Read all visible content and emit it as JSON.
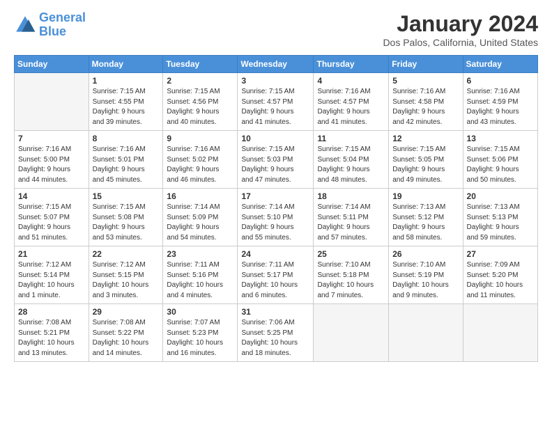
{
  "logo": {
    "line1": "General",
    "line2": "Blue"
  },
  "title": "January 2024",
  "location": "Dos Palos, California, United States",
  "days_of_week": [
    "Sunday",
    "Monday",
    "Tuesday",
    "Wednesday",
    "Thursday",
    "Friday",
    "Saturday"
  ],
  "weeks": [
    [
      {
        "day": "",
        "info": ""
      },
      {
        "day": "1",
        "info": "Sunrise: 7:15 AM\nSunset: 4:55 PM\nDaylight: 9 hours\nand 39 minutes."
      },
      {
        "day": "2",
        "info": "Sunrise: 7:15 AM\nSunset: 4:56 PM\nDaylight: 9 hours\nand 40 minutes."
      },
      {
        "day": "3",
        "info": "Sunrise: 7:15 AM\nSunset: 4:57 PM\nDaylight: 9 hours\nand 41 minutes."
      },
      {
        "day": "4",
        "info": "Sunrise: 7:16 AM\nSunset: 4:57 PM\nDaylight: 9 hours\nand 41 minutes."
      },
      {
        "day": "5",
        "info": "Sunrise: 7:16 AM\nSunset: 4:58 PM\nDaylight: 9 hours\nand 42 minutes."
      },
      {
        "day": "6",
        "info": "Sunrise: 7:16 AM\nSunset: 4:59 PM\nDaylight: 9 hours\nand 43 minutes."
      }
    ],
    [
      {
        "day": "7",
        "info": "Sunrise: 7:16 AM\nSunset: 5:00 PM\nDaylight: 9 hours\nand 44 minutes."
      },
      {
        "day": "8",
        "info": "Sunrise: 7:16 AM\nSunset: 5:01 PM\nDaylight: 9 hours\nand 45 minutes."
      },
      {
        "day": "9",
        "info": "Sunrise: 7:16 AM\nSunset: 5:02 PM\nDaylight: 9 hours\nand 46 minutes."
      },
      {
        "day": "10",
        "info": "Sunrise: 7:15 AM\nSunset: 5:03 PM\nDaylight: 9 hours\nand 47 minutes."
      },
      {
        "day": "11",
        "info": "Sunrise: 7:15 AM\nSunset: 5:04 PM\nDaylight: 9 hours\nand 48 minutes."
      },
      {
        "day": "12",
        "info": "Sunrise: 7:15 AM\nSunset: 5:05 PM\nDaylight: 9 hours\nand 49 minutes."
      },
      {
        "day": "13",
        "info": "Sunrise: 7:15 AM\nSunset: 5:06 PM\nDaylight: 9 hours\nand 50 minutes."
      }
    ],
    [
      {
        "day": "14",
        "info": "Sunrise: 7:15 AM\nSunset: 5:07 PM\nDaylight: 9 hours\nand 51 minutes."
      },
      {
        "day": "15",
        "info": "Sunrise: 7:15 AM\nSunset: 5:08 PM\nDaylight: 9 hours\nand 53 minutes."
      },
      {
        "day": "16",
        "info": "Sunrise: 7:14 AM\nSunset: 5:09 PM\nDaylight: 9 hours\nand 54 minutes."
      },
      {
        "day": "17",
        "info": "Sunrise: 7:14 AM\nSunset: 5:10 PM\nDaylight: 9 hours\nand 55 minutes."
      },
      {
        "day": "18",
        "info": "Sunrise: 7:14 AM\nSunset: 5:11 PM\nDaylight: 9 hours\nand 57 minutes."
      },
      {
        "day": "19",
        "info": "Sunrise: 7:13 AM\nSunset: 5:12 PM\nDaylight: 9 hours\nand 58 minutes."
      },
      {
        "day": "20",
        "info": "Sunrise: 7:13 AM\nSunset: 5:13 PM\nDaylight: 9 hours\nand 59 minutes."
      }
    ],
    [
      {
        "day": "21",
        "info": "Sunrise: 7:12 AM\nSunset: 5:14 PM\nDaylight: 10 hours\nand 1 minute."
      },
      {
        "day": "22",
        "info": "Sunrise: 7:12 AM\nSunset: 5:15 PM\nDaylight: 10 hours\nand 3 minutes."
      },
      {
        "day": "23",
        "info": "Sunrise: 7:11 AM\nSunset: 5:16 PM\nDaylight: 10 hours\nand 4 minutes."
      },
      {
        "day": "24",
        "info": "Sunrise: 7:11 AM\nSunset: 5:17 PM\nDaylight: 10 hours\nand 6 minutes."
      },
      {
        "day": "25",
        "info": "Sunrise: 7:10 AM\nSunset: 5:18 PM\nDaylight: 10 hours\nand 7 minutes."
      },
      {
        "day": "26",
        "info": "Sunrise: 7:10 AM\nSunset: 5:19 PM\nDaylight: 10 hours\nand 9 minutes."
      },
      {
        "day": "27",
        "info": "Sunrise: 7:09 AM\nSunset: 5:20 PM\nDaylight: 10 hours\nand 11 minutes."
      }
    ],
    [
      {
        "day": "28",
        "info": "Sunrise: 7:08 AM\nSunset: 5:21 PM\nDaylight: 10 hours\nand 13 minutes."
      },
      {
        "day": "29",
        "info": "Sunrise: 7:08 AM\nSunset: 5:22 PM\nDaylight: 10 hours\nand 14 minutes."
      },
      {
        "day": "30",
        "info": "Sunrise: 7:07 AM\nSunset: 5:23 PM\nDaylight: 10 hours\nand 16 minutes."
      },
      {
        "day": "31",
        "info": "Sunrise: 7:06 AM\nSunset: 5:25 PM\nDaylight: 10 hours\nand 18 minutes."
      },
      {
        "day": "",
        "info": ""
      },
      {
        "day": "",
        "info": ""
      },
      {
        "day": "",
        "info": ""
      }
    ]
  ]
}
